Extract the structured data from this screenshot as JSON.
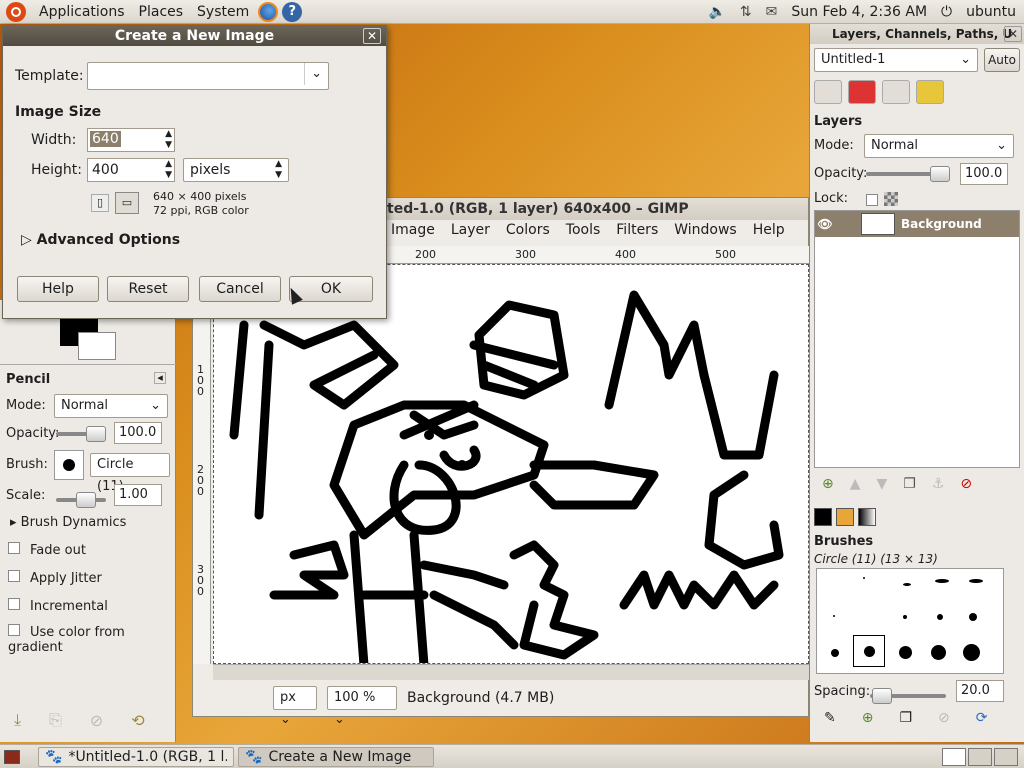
{
  "top_panel": {
    "menus": [
      "Applications",
      "Places",
      "System"
    ],
    "datetime": "Sun Feb  4,  2:36 AM",
    "user": "ubuntu"
  },
  "dialog": {
    "title": "Create a New Image",
    "template_label": "Template:",
    "template_value": "",
    "image_size_label": "Image Size",
    "width_label": "Width:",
    "width_value": "640",
    "height_label": "Height:",
    "height_value": "400",
    "unit": "pixels",
    "info_line1": "640 × 400 pixels",
    "info_line2": "72 ppi, RGB color",
    "advanced_label": "Advanced Options",
    "buttons": {
      "help": "Help",
      "reset": "Reset",
      "cancel": "Cancel",
      "ok": "OK"
    }
  },
  "image_window": {
    "title": "ted-1.0 (RGB, 1 layer) 640x400 – GIMP",
    "menu": [
      "Image",
      "Layer",
      "Colors",
      "Tools",
      "Filters",
      "Windows",
      "Help"
    ],
    "ruler_h": [
      "200",
      "300",
      "400",
      "500"
    ],
    "ruler_v": [
      "1\n0\n0",
      "2\n0\n0",
      "3\n0\n0"
    ],
    "status_unit": "px",
    "status_zoom": "100 %",
    "status_text": "Background (4.7 MB)"
  },
  "toolbox": {
    "title": "Pencil",
    "mode_label": "Mode:",
    "mode_value": "Normal",
    "opacity_label": "Opacity:",
    "opacity_value": "100.0",
    "brush_label": "Brush:",
    "brush_value": "Circle (11)",
    "scale_label": "Scale:",
    "scale_value": "1.00",
    "dynamics_label": "Brush Dynamics",
    "checkboxes": [
      "Fade out",
      "Apply Jitter",
      "Incremental",
      "Use color from gradient"
    ]
  },
  "dock": {
    "title": "Layers, Channels, Paths, U",
    "image_select": "Untitled-1",
    "auto_label": "Auto",
    "layers_label": "Layers",
    "mode_label": "Mode:",
    "mode_value": "Normal",
    "opacity_label": "Opacity:",
    "opacity_value": "100.0",
    "lock_label": "Lock:",
    "layer_name": "Background",
    "brushes_label": "Brushes",
    "brush_name": "Circle (11) (13 × 13)",
    "spacing_label": "Spacing:",
    "spacing_value": "20.0"
  },
  "bottom_panel": {
    "tasks": [
      "*Untitled-1.0 (RGB, 1 l...",
      "Create a New Image"
    ]
  },
  "colors": {
    "layer_selected": "#8c7f6c",
    "dialog_title": "#5a5449",
    "accent_orange": "#dd4814"
  }
}
